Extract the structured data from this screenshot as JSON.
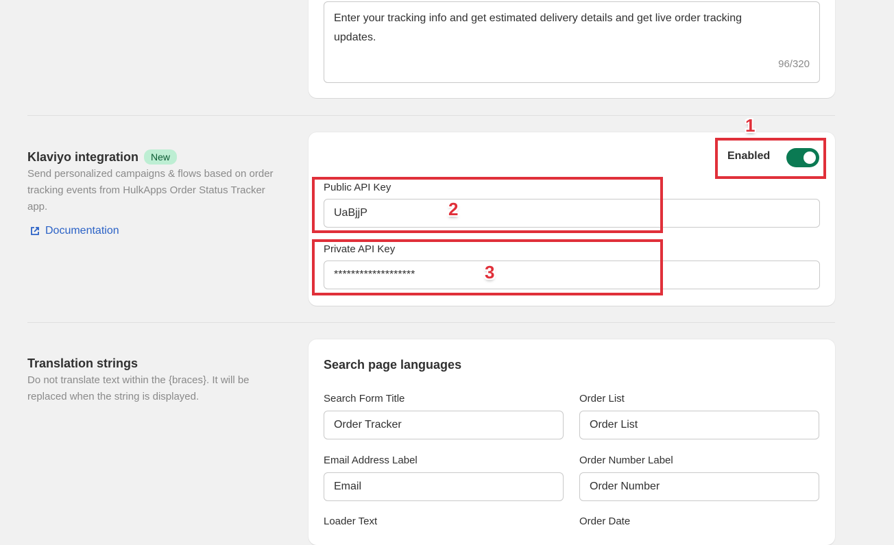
{
  "tracking_message": {
    "value": "Enter your tracking info and get estimated delivery details and get live order tracking updates.",
    "counter": "96/320"
  },
  "klaviyo": {
    "title": "Klaviyo integration",
    "badge": "New",
    "description": "Send personalized campaigns & flows based on order tracking events from HulkApps Order Status Tracker app.",
    "doc_link": "Documentation",
    "enabled_label": "Enabled",
    "enabled": true,
    "public_key_label": "Public API Key",
    "public_key_value": "UaBjjP",
    "private_key_label": "Private API Key",
    "private_key_value": "*******************"
  },
  "annotations": {
    "one": "1",
    "two": "2",
    "three": "3",
    "color": "#e0303a"
  },
  "translation": {
    "title": "Translation strings",
    "description": "Do not translate text within the {braces}. It will be replaced when the string is displayed.",
    "card_title": "Search page languages",
    "fields": {
      "search_form_title": {
        "label": "Search Form Title",
        "value": "Order Tracker"
      },
      "order_list": {
        "label": "Order List",
        "value": "Order List"
      },
      "email_address_label": {
        "label": "Email Address Label",
        "value": "Email"
      },
      "order_number_label": {
        "label": "Order Number Label",
        "value": "Order Number"
      },
      "loader_text": {
        "label": "Loader Text"
      },
      "order_date": {
        "label": "Order Date"
      }
    }
  },
  "colors": {
    "background": "#f1f1f1",
    "toggle_on": "#0b7a53",
    "badge_bg": "#bdeed3",
    "link": "#2b62c6"
  }
}
